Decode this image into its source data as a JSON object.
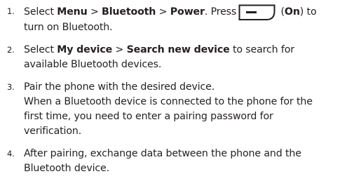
{
  "steps": [
    {
      "number": "1.",
      "parts": {
        "a": "Select ",
        "b1": "Menu",
        "sep1": " > ",
        "b2": "Bluetooth",
        "sep2": " > ",
        "b3": "Power",
        "c": ". Press",
        "d": " (",
        "on": "On",
        "e": ") to",
        "f": "turn on Bluetooth."
      },
      "key_icon": "left-softkey-icon"
    },
    {
      "number": "2.",
      "parts": {
        "a": "Select ",
        "b1": "My device",
        "sep1": " > ",
        "b2": "Search new device",
        "c": " to search for",
        "d": "available Bluetooth devices."
      }
    },
    {
      "number": "3.",
      "lines": [
        "Pair the phone with the desired device.",
        "When a Bluetooth device is connected to the phone for the",
        "first time, you need to enter a pairing password for",
        "verification."
      ]
    },
    {
      "number": "4.",
      "lines": [
        "After pairing, exchange data between the phone and the",
        "Bluetooth device."
      ]
    }
  ]
}
